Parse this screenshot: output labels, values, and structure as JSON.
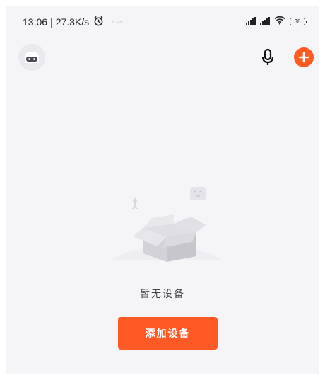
{
  "status_bar": {
    "time": "13:06",
    "separator": "|",
    "speed": "27.3K/s",
    "battery": "38",
    "icons": [
      "alarm-icon",
      "notification-icon",
      "cellular-signal-icon",
      "wifi-icon",
      "battery-icon"
    ]
  },
  "header": {
    "icons": [
      "avatar-icon",
      "microphone-icon",
      "plus-icon"
    ],
    "accent_color": "#ff5a1f"
  },
  "empty_state": {
    "message": "暂无设备",
    "illustration": "empty-box-icon"
  },
  "actions": {
    "add_device_label": "添加设备",
    "button_color": "#ff5a26"
  }
}
